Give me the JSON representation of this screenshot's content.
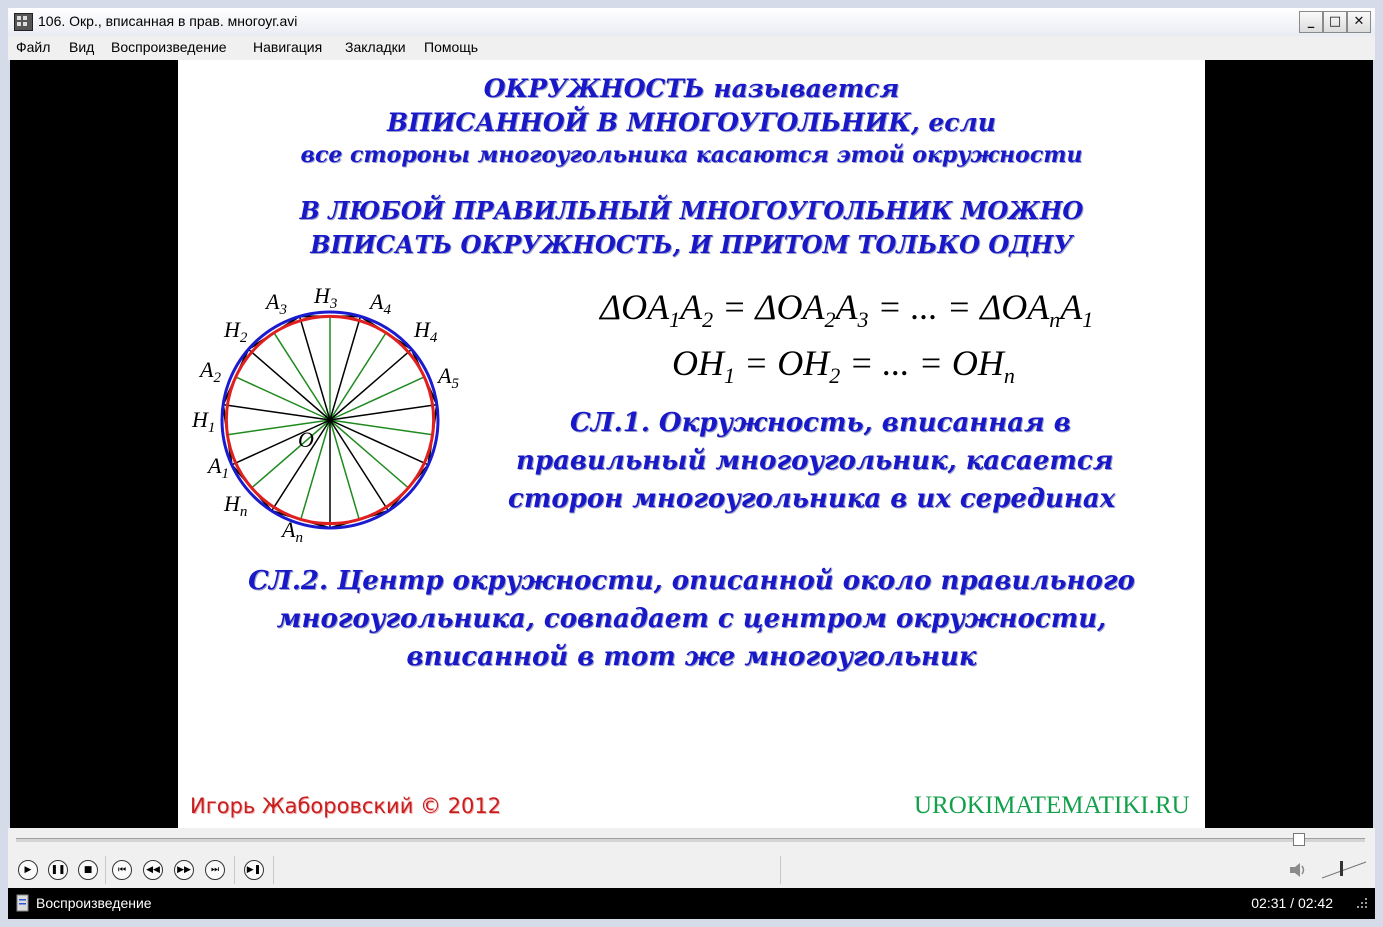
{
  "window": {
    "title": "106. Окр., вписанная в прав. многоуг.avi",
    "minimize_glyph": "_",
    "maximize_glyph": "□",
    "close_glyph": "✕"
  },
  "menu": [
    {
      "label": "Файл"
    },
    {
      "label": "Вид"
    },
    {
      "label": "Воспроизведение"
    },
    {
      "label": "Навигация"
    },
    {
      "label": "Закладки"
    },
    {
      "label": "Помощь"
    }
  ],
  "slide": {
    "def_line1": "ОКРУЖНОСТЬ называется",
    "def_line2": "ВПИСАННОЙ В МНОГОУГОЛЬНИК, если",
    "def_line3": "все стороны многоугольника касаются этой окружности",
    "thm_line1": "В ЛЮБОЙ ПРАВИЛЬНЫЙ МНОГОУГОЛЬНИК МОЖНО",
    "thm_line2": "ВПИСАТЬ ОКРУЖНОСТЬ, И ПРИТОМ ТОЛЬКО ОДНУ",
    "cor1_line1": "СЛ.1. Окружность, вписанная в",
    "cor1_line2": "правильный многоугольник, касается",
    "cor1_line3": "сторон многоугольника в их серединах",
    "cor2_line1": "СЛ.2. Центр окружности, описанной около правильного",
    "cor2_line2": "многоугольника, совпадает с центром окружности,",
    "cor2_line3": "вписанной в тот же многоугольник",
    "author": "Игорь Жаборовский © 2012",
    "site": "UROKIMATEMATIKI.RU",
    "equations": {
      "eq1": {
        "t1": "ΔOA",
        "s1": "1",
        "t2": "A",
        "s2": "2",
        "t3": " = ΔOA",
        "s3": "2",
        "t4": "A",
        "s4": "3",
        "t5": " = ... = ΔOA",
        "s5": "n",
        "t6": "A",
        "s6": "1"
      },
      "eq2": {
        "t1": "OH",
        "s1": "1",
        "t2": " = OH",
        "s2": "2",
        "t3": " = ... = OH",
        "s3": "n"
      }
    },
    "figure": {
      "center_label": "O",
      "labels": {
        "A3": {
          "main": "A",
          "sub": "3"
        },
        "H3": {
          "main": "H",
          "sub": "3"
        },
        "A4": {
          "main": "A",
          "sub": "4"
        },
        "H4": {
          "main": "H",
          "sub": "4"
        },
        "A5": {
          "main": "A",
          "sub": "5"
        },
        "H2": {
          "main": "H",
          "sub": "2"
        },
        "A2": {
          "main": "A",
          "sub": "2"
        },
        "H1": {
          "main": "H",
          "sub": "1"
        },
        "A1": {
          "main": "A",
          "sub": "1"
        },
        "Hn": {
          "main": "H",
          "sub": "n"
        },
        "An": {
          "main": "A",
          "sub": "n"
        }
      },
      "colors": {
        "circumscribed": "#1a1ad0",
        "inscribed": "#e02020",
        "polygon": "#000000",
        "radii_to_vertices": "#000000",
        "radii_to_midpoints": "#1f8a1f"
      }
    }
  },
  "player": {
    "progress_fraction": 0.95,
    "status": "Воспроизведение",
    "time": "02:31 / 02:42",
    "buttons": [
      {
        "name": "play-button",
        "glyph": "▶"
      },
      {
        "name": "pause-button",
        "glyph": "❚❚"
      },
      {
        "name": "stop-button",
        "glyph": "■"
      },
      {
        "name": "prev-button",
        "glyph": "⏮"
      },
      {
        "name": "rewind-button",
        "glyph": "◀◀"
      },
      {
        "name": "forward-button",
        "glyph": "▶▶"
      },
      {
        "name": "next-button",
        "glyph": "⏭"
      },
      {
        "name": "frame-step-button",
        "glyph": "▶❚"
      }
    ]
  }
}
